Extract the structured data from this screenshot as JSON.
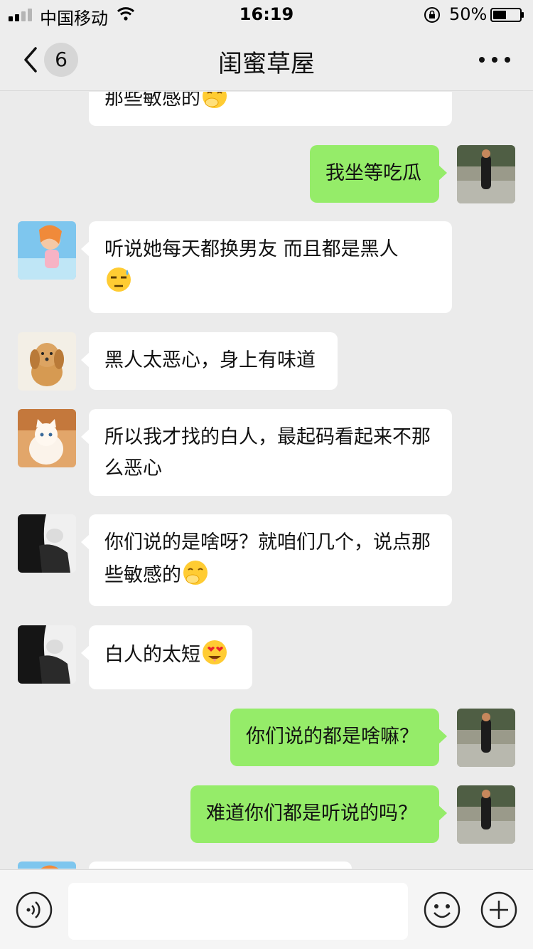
{
  "status_bar": {
    "carrier": "中国移动",
    "time": "16:19",
    "battery_percent": "50%",
    "battery_level": 0.5
  },
  "nav": {
    "unread_count": "6",
    "title": "闺蜜草屋"
  },
  "messages": [
    {
      "side": "in",
      "text": "那些敏感的",
      "emoji": "hand-over-mouth-emoji"
    },
    {
      "side": "out",
      "text": "我坐等吃瓜"
    },
    {
      "side": "in",
      "text": "听说她每天都换男友 而且都是黑人",
      "emoji": "unamused-sweat-emoji"
    },
    {
      "side": "in",
      "text": "黑人太恶心，身上有味道"
    },
    {
      "side": "in",
      "text": "所以我才找的白人，最起码看起来不那么恶心"
    },
    {
      "side": "in",
      "text": "你们说的是啥呀？就咱们几个，说点那些敏感的",
      "emoji": "hand-over-mouth-emoji"
    },
    {
      "side": "in",
      "text": "白人的太短",
      "emoji": "heart-eyes-drool-emoji"
    },
    {
      "side": "out",
      "text": "你们说的都是啥嘛？"
    },
    {
      "side": "out",
      "text": "难道你们都是听说的吗？"
    }
  ],
  "colors": {
    "outgoing_bubble": "#95ec69",
    "incoming_bubble": "#ffffff",
    "background": "#ebebeb"
  }
}
